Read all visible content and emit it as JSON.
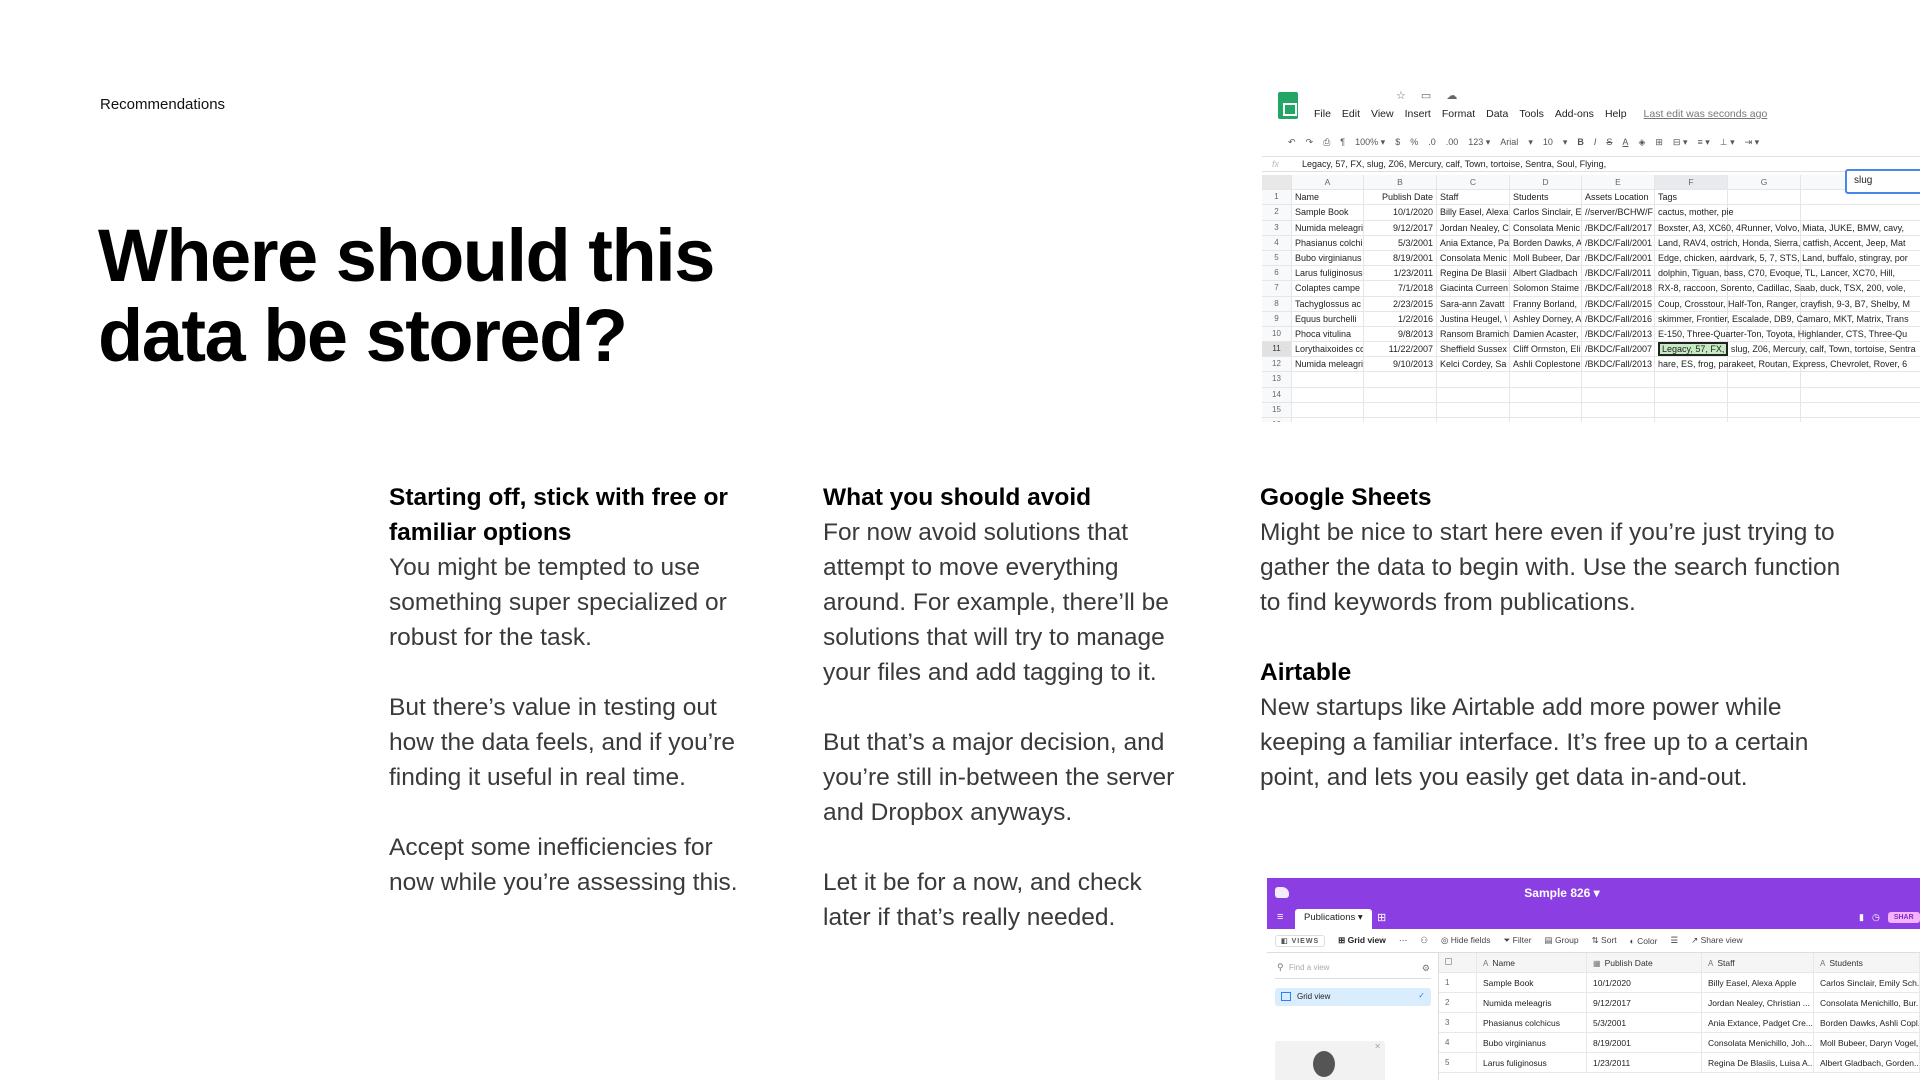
{
  "eyebrow": "Recommendations",
  "headline": "Where should this data be stored?",
  "columns": {
    "col1": {
      "title": "Starting off, stick with free or familiar options",
      "paragraphs": [
        "You might be tempted to use something super specialized or robust for the task.",
        "But there’s value in testing out how the data feels, and if you’re finding it useful in real time.",
        "Accept some inefficiencies for now while you’re assessing this."
      ]
    },
    "col2": {
      "title": "What you should avoid",
      "paragraphs": [
        "For now avoid solutions that attempt to move everything around. For example, there’ll be solutions that will try to manage your files and add tagging to it.",
        "But that’s a major decision, and you’re still in-between the server and Dropbox anyways.",
        "Let it be for a now, and check later if that’s really needed."
      ]
    },
    "col3": {
      "gs_title": "Google Sheets",
      "gs_text": "Might be nice to start here even if you’re just trying to gather the data to begin with. Use the search function to find keywords from publications.",
      "at_title": "Airtable",
      "at_text": "New startups like Airtable add more power while keeping a familiar interface. It’s free up to a certain point, and lets you easily get data in-and-out."
    }
  },
  "sheets": {
    "top_icons": "☆ ▭ ☁",
    "menu": [
      "File",
      "Edit",
      "View",
      "Insert",
      "Format",
      "Data",
      "Tools",
      "Add-ons",
      "Help"
    ],
    "last_edit": "Last edit was seconds ago",
    "toolbar": [
      "↶",
      "↷",
      "⎙",
      "¶",
      "100% ▾",
      "$",
      "%",
      ".0",
      ".00",
      "123 ▾",
      "Arial",
      "▾",
      "10",
      "▾",
      "B",
      "I",
      "S",
      "A",
      "◈",
      "⊞",
      "⊟ ▾",
      "≡ ▾",
      "⊥ ▾",
      "⇥ ▾"
    ],
    "fx_label": "fx",
    "formula": "Legacy, 57, FX, slug, Z06, Mercury, calf, Town, tortoise, Sentra, Soul, Flying,",
    "search_value": "slug",
    "col_letters": [
      "A",
      "B",
      "C",
      "D",
      "E",
      "F",
      "G",
      ""
    ],
    "rows": [
      {
        "n": "1",
        "a": "Name",
        "b": "Publish Date",
        "c": "Staff",
        "d": "Students",
        "e": "Assets Location",
        "f": "Tags"
      },
      {
        "n": "2",
        "a": "Sample Book",
        "b": "10/1/2020",
        "c": "Billy Easel, Alexa",
        "d": "Carlos Sinclair, E",
        "e": "//server/BCHW/F",
        "f": "cactus, mother, pie"
      },
      {
        "n": "3",
        "a": "Numida meleagri",
        "b": "9/12/2017",
        "c": "Jordan Nealey, C",
        "d": "Consolata Menic",
        "e": "/BKDC/Fall/2017",
        "f": "Boxster, A3, XC60, 4Runner, Volvo, Miata, JUKE, BMW, cavy,"
      },
      {
        "n": "4",
        "a": "Phasianus colchi",
        "b": "5/3/2001",
        "c": "Ania Extance, Pa",
        "d": "Borden Dawks, A",
        "e": "/BKDC/Fall/2001",
        "f": "Land, RAV4, ostrich, Honda, Sierra, catfish, Accent, Jeep, Mat"
      },
      {
        "n": "5",
        "a": "Bubo virginianus",
        "b": "8/19/2001",
        "c": "Consolata Menic",
        "d": "Moll Bubeer, Dar",
        "e": "/BKDC/Fall/2001",
        "f": "Edge, chicken, aardvark, 5, 7, STS, Land, buffalo, stingray, por"
      },
      {
        "n": "6",
        "a": "Larus fuliginosus",
        "b": "1/23/2011",
        "c": "Regina De Blasii",
        "d": "Albert Gladbach",
        "e": "/BKDC/Fall/2011",
        "f": "dolphin, Tiguan, bass, C70, Evoque, TL, Lancer, XC70, Hill,"
      },
      {
        "n": "7",
        "a": "Colaptes campe",
        "b": "7/1/2018",
        "c": "Giacinta Curreen",
        "d": "Solomon Staime",
        "e": "/BKDC/Fall/2018",
        "f": "RX-8, raccoon, Sorento, Cadillac, Saab, duck, TSX, 200, vole,"
      },
      {
        "n": "8",
        "a": "Tachyglossus ac",
        "b": "2/23/2015",
        "c": "Sara-ann Zavatt",
        "d": "Franny Borland,",
        "e": "/BKDC/Fall/2015",
        "f": "Coup, Crosstour, Half-Ton, Ranger, crayfish, 9-3, B7, Shelby, M"
      },
      {
        "n": "9",
        "a": "Equus burchelli",
        "b": "1/2/2016",
        "c": "Justina Heugel, \\",
        "d": "Ashley Dorney, A",
        "e": "/BKDC/Fall/2016",
        "f": "skimmer, Frontier, Escalade, DB9, Camaro, MKT, Matrix, Trans"
      },
      {
        "n": "10",
        "a": "Phoca vitulina",
        "b": "9/8/2013",
        "c": "Ransom Bramich",
        "d": "Damien Acaster,",
        "e": "/BKDC/Fall/2013",
        "f": "E-150, Three-Quarter-Ton, Toyota, Highlander, CTS, Three-Qu"
      },
      {
        "n": "11",
        "a": "Lorythaixoides co",
        "b": "11/22/2007",
        "c": "Sheffield Sussex",
        "d": "Cliff Ormston, Eli",
        "e": "/BKDC/Fall/2007",
        "f_hl": "Legacy, 57, FX,",
        "f": "slug, Z06, Mercury, calf, Town, tortoise, Sentra"
      },
      {
        "n": "12",
        "a": "Numida meleagri",
        "b": "9/10/2013",
        "c": "Kelci Cordey, Sa",
        "d": "Ashli Coplestone",
        "e": "/BKDC/Fall/2013",
        "f": "hare, ES, frog, parakeet, Routan, Express, Chevrolet, Rover, 6"
      },
      {
        "n": "13",
        "a": "",
        "b": "",
        "c": "",
        "d": "",
        "e": "",
        "f": ""
      },
      {
        "n": "14",
        "a": "",
        "b": "",
        "c": "",
        "d": "",
        "e": "",
        "f": ""
      },
      {
        "n": "15",
        "a": "",
        "b": "",
        "c": "",
        "d": "",
        "e": "",
        "f": ""
      },
      {
        "n": "16",
        "a": "",
        "b": "",
        "c": "",
        "d": "",
        "e": "",
        "f": ""
      }
    ]
  },
  "airtable": {
    "base_name": "Sample 826 ▾",
    "tab": "Publications ▾",
    "share_label": "SHAR",
    "viewbar": {
      "views": "VIEWS",
      "grid_view": "Grid view",
      "hide_fields": "Hide fields",
      "filter": "Filter",
      "group": "Group",
      "sort": "Sort",
      "color": "Color",
      "share_view": "Share view"
    },
    "find_placeholder": "Find a view",
    "sidebar_view": "Grid view",
    "headers": [
      "Name",
      "Publish Date",
      "Staff",
      "Students"
    ],
    "rows": [
      {
        "n": "1",
        "name": "Sample Book",
        "date": "10/1/2020",
        "staff": "Billy Easel, Alexa Apple",
        "students": "Carlos Sinclair, Emily Sch..."
      },
      {
        "n": "2",
        "name": "Numida meleagris",
        "date": "9/12/2017",
        "staff": "Jordan Nealey, Christian ...",
        "students": "Consolata Menichillo, Bur..."
      },
      {
        "n": "3",
        "name": "Phasianus colchicus",
        "date": "5/3/2001",
        "staff": "Ania Extance, Padget Cre...",
        "students": "Borden Dawks, Ashli Copl..."
      },
      {
        "n": "4",
        "name": "Bubo virginianus",
        "date": "8/19/2001",
        "staff": "Consolata Menichillo, Joh...",
        "students": "Moll Bubeer, Daryn Vogel,..."
      },
      {
        "n": "5",
        "name": "Larus fuliginosus",
        "date": "1/23/2011",
        "staff": "Regina De Blasiis, Luisa A...",
        "students": "Albert Gladbach, Gorden..."
      }
    ]
  },
  "colors": {
    "sheets_green": "#23a566",
    "airtable_purple": "#8b3fe3",
    "search_border": "#4a86e8",
    "highlight": "#c6ebc2"
  }
}
